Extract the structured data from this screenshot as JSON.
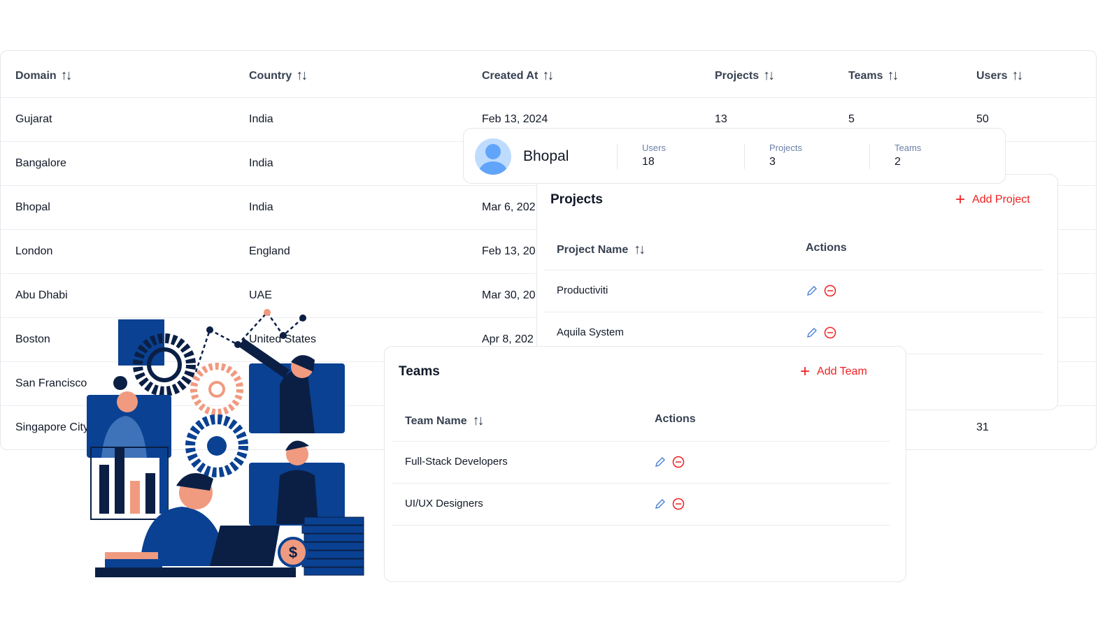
{
  "table": {
    "headers": [
      "Domain",
      "Country",
      "Created At",
      "Projects",
      "Teams",
      "Users"
    ],
    "rows": [
      [
        "Gujarat",
        "India",
        "Feb 13, 2024",
        "13",
        "5",
        "50"
      ],
      [
        "Bangalore",
        "India",
        "",
        "",
        "",
        ""
      ],
      [
        "Bhopal",
        "India",
        "Mar 6, 202",
        "",
        "",
        ""
      ],
      [
        "London",
        "England",
        "Feb 13, 20",
        "",
        "",
        ""
      ],
      [
        "Abu Dhabi",
        "UAE",
        "Mar 30, 20",
        "",
        "",
        ""
      ],
      [
        "Boston",
        "United States",
        "Apr 8, 202",
        "",
        "",
        ""
      ],
      [
        "San Francisco",
        "",
        "",
        "",
        "",
        ""
      ],
      [
        "Singapore City",
        "",
        "",
        "",
        "",
        "31"
      ]
    ]
  },
  "detail": {
    "name": "Bhopal",
    "stats": [
      {
        "label": "Users",
        "value": "18"
      },
      {
        "label": "Projects",
        "value": "3"
      },
      {
        "label": "Teams",
        "value": "2"
      }
    ]
  },
  "projects": {
    "title": "Projects",
    "add_label": "Add Project",
    "col_name": "Project Name",
    "col_actions": "Actions",
    "items": [
      "Productiviti",
      "Aquila System"
    ]
  },
  "teams": {
    "title": "Teams",
    "add_label": "Add Team",
    "col_name": "Team Name",
    "col_actions": "Actions",
    "items": [
      "Full-Stack Developers",
      "UI/UX Designers"
    ]
  },
  "colors": {
    "accent_red": "#ef2020",
    "edit_blue": "#4a7fd0",
    "illustration_blue": "#0a4192",
    "illustration_navy": "#0b1f45",
    "illustration_salmon": "#f09a80"
  }
}
